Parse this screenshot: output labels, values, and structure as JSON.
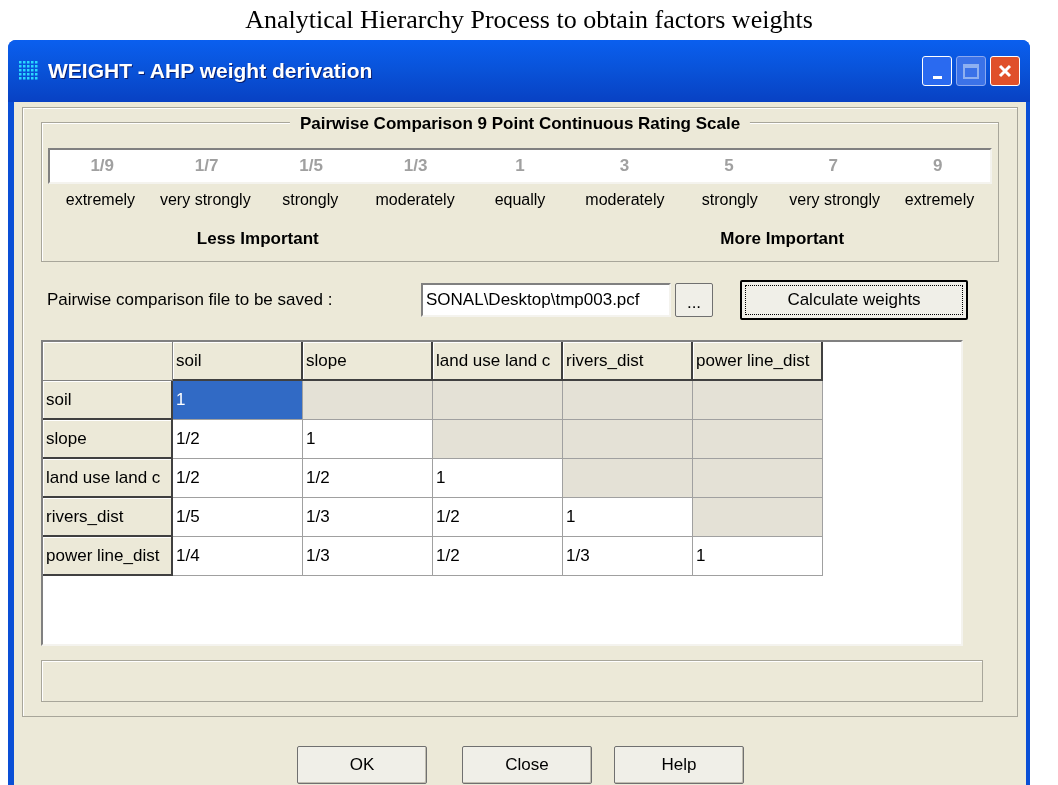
{
  "caption": "Analytical Hierarchy Process to obtain factors weights",
  "window": {
    "title": "WEIGHT - AHP weight derivation"
  },
  "scale": {
    "title": "Pairwise Comparison 9 Point Continuous Rating Scale",
    "points": [
      {
        "value": "1/9",
        "label": "extremely"
      },
      {
        "value": "1/7",
        "label": "very strongly"
      },
      {
        "value": "1/5",
        "label": "strongly"
      },
      {
        "value": "1/3",
        "label": "moderately"
      },
      {
        "value": "1",
        "label": "equally"
      },
      {
        "value": "3",
        "label": "moderately"
      },
      {
        "value": "5",
        "label": "strongly"
      },
      {
        "value": "7",
        "label": "very strongly"
      },
      {
        "value": "9",
        "label": "extremely"
      }
    ],
    "less_label": "Less Important",
    "more_label": "More Important"
  },
  "file": {
    "label": "Pairwise comparison file to be saved :",
    "value": "SONAL\\Desktop\\tmp003.pcf",
    "browse": "...",
    "calculate": "Calculate weights"
  },
  "table": {
    "columns": [
      "soil",
      "slope",
      "land use land c",
      "rivers_dist",
      "power line_dist"
    ],
    "rows": [
      {
        "name": "soil",
        "cells": [
          {
            "value": "1",
            "selected": true,
            "disabled": false
          },
          {
            "selected": false,
            "disabled": true
          },
          {
            "selected": false,
            "disabled": true
          },
          {
            "selected": false,
            "disabled": true
          },
          {
            "selected": false,
            "disabled": true
          }
        ]
      },
      {
        "name": "slope",
        "cells": [
          {
            "value": "1/2",
            "selected": false,
            "disabled": false
          },
          {
            "value": "1",
            "selected": false,
            "disabled": false
          },
          {
            "selected": false,
            "disabled": true
          },
          {
            "selected": false,
            "disabled": true
          },
          {
            "selected": false,
            "disabled": true
          }
        ]
      },
      {
        "name": "land use land c",
        "cells": [
          {
            "value": "1/2",
            "selected": false,
            "disabled": false
          },
          {
            "value": "1/2",
            "selected": false,
            "disabled": false
          },
          {
            "value": "1",
            "selected": false,
            "disabled": false
          },
          {
            "selected": false,
            "disabled": true
          },
          {
            "selected": false,
            "disabled": true
          }
        ]
      },
      {
        "name": "rivers_dist",
        "cells": [
          {
            "value": "1/5",
            "selected": false,
            "disabled": false
          },
          {
            "value": "1/3",
            "selected": false,
            "disabled": false
          },
          {
            "value": "1/2",
            "selected": false,
            "disabled": false
          },
          {
            "value": "1",
            "selected": false,
            "disabled": false
          },
          {
            "selected": false,
            "disabled": true
          }
        ]
      },
      {
        "name": "power line_dist",
        "cells": [
          {
            "value": "1/4",
            "selected": false,
            "disabled": false
          },
          {
            "value": "1/3",
            "selected": false,
            "disabled": false
          },
          {
            "value": "1/2",
            "selected": false,
            "disabled": false
          },
          {
            "value": "1/3",
            "selected": false,
            "disabled": false
          },
          {
            "value": "1",
            "selected": false,
            "disabled": false
          }
        ]
      }
    ]
  },
  "buttons": [
    "OK",
    "Close",
    "Help"
  ]
}
